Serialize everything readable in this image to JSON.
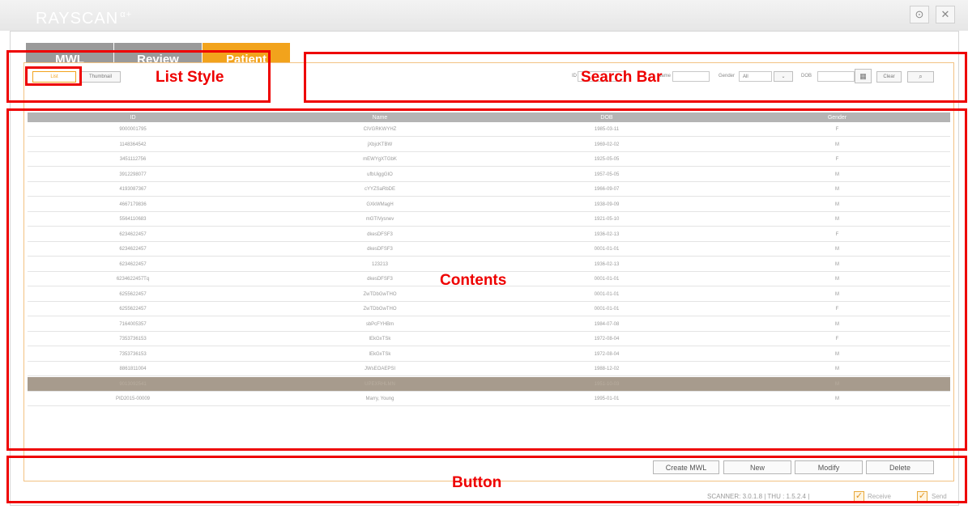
{
  "app": {
    "brand": "RAYSCAN",
    "brand_suffix": "α+"
  },
  "window_controls": {
    "settings_icon": "settings-icon",
    "close_icon": "close-icon"
  },
  "tabs": [
    {
      "label": "MWL",
      "active": false
    },
    {
      "label": "Review",
      "active": false
    },
    {
      "label": "Patient",
      "active": true
    }
  ],
  "list_style": {
    "list_label": "List",
    "thumbnail_label": "Thumbnail"
  },
  "search": {
    "id_label": "ID",
    "name_label": "Name",
    "gender_label": "Gender",
    "gender_value": "All",
    "dob_label": "DOB",
    "clear_label": "Clear",
    "search_icon": "search-icon",
    "calendar_icon": "calendar-icon"
  },
  "table": {
    "columns": [
      "ID",
      "Name",
      "DOB",
      "Gender"
    ],
    "rows": [
      {
        "id": "9000001795",
        "name": "CIVGRKWYHZ",
        "dob": "1985-03-11",
        "gender": "F"
      },
      {
        "id": "1148364542",
        "name": "jXbjcKTBW",
        "dob": "1969-02-02",
        "gender": "M"
      },
      {
        "id": "3451112756",
        "name": "mEWYgXTGbK",
        "dob": "1925-05-05",
        "gender": "F"
      },
      {
        "id": "3912298077",
        "name": "ufbUiggGIO",
        "dob": "1957-05-05",
        "gender": "M"
      },
      {
        "id": "4193087367",
        "name": "cYYZSaRbDE",
        "dob": "1966-09-07",
        "gender": "M"
      },
      {
        "id": "4667179836",
        "name": "GXkWMagH",
        "dob": "1938-09-09",
        "gender": "M"
      },
      {
        "id": "5564110683",
        "name": "mGTIVysnev",
        "dob": "1921-05-10",
        "gender": "M"
      },
      {
        "id": "6234622457",
        "name": "dkesDFSF3",
        "dob": "1936-02-13",
        "gender": "F"
      },
      {
        "id": "6234622457",
        "name": "dkesDFSF3",
        "dob": "0001-01-01",
        "gender": "M"
      },
      {
        "id": "6234622457",
        "name": "123213",
        "dob": "1936-02-13",
        "gender": "M"
      },
      {
        "id": "6234622457Tq",
        "name": "dkesDFSF3",
        "dob": "0001-01-01",
        "gender": "M"
      },
      {
        "id": "6255622457",
        "name": "ZwTDbGwTHO",
        "dob": "0001-01-01",
        "gender": "M"
      },
      {
        "id": "6255622457",
        "name": "ZwTDbGwTHO",
        "dob": "0001-01-01",
        "gender": "F"
      },
      {
        "id": "7164005357",
        "name": "sbPcFYHBm",
        "dob": "1984-07-08",
        "gender": "M"
      },
      {
        "id": "7353736153",
        "name": "lEkGxTSk",
        "dob": "1972-08-04",
        "gender": "F"
      },
      {
        "id": "7353736153",
        "name": "lEkGxTSk",
        "dob": "1972-08-04",
        "gender": "M"
      },
      {
        "id": "8861811004",
        "name": "JWsEOAEPSI",
        "dob": "1988-12-02",
        "gender": "M"
      },
      {
        "id": "9013092541",
        "name": "UPEXRHLMN",
        "dob": "1951-10-03",
        "gender": "M",
        "selected": true
      },
      {
        "id": "PID2015-00009",
        "name": "Marry, Young",
        "dob": "1995-01-01",
        "gender": "M"
      }
    ]
  },
  "actions": {
    "create_mwl": "Create MWL",
    "new": "New",
    "modify": "Modify",
    "delete": "Delete"
  },
  "status": {
    "text": "SCANNER: 3.0.1.8 | THU : 1.5.2.4 |",
    "receive_label": "Receive",
    "send_label": "Send",
    "receive_checked": true,
    "send_checked": true
  },
  "annotations": {
    "list_style": "List Style",
    "search_bar": "Search Bar",
    "contents": "Contents",
    "button": "Button"
  },
  "colors": {
    "accent": "#f2a31c",
    "annotation": "#ee0000",
    "tab_inactive": "#9a9a9a",
    "selected_row": "#a79b8d"
  }
}
